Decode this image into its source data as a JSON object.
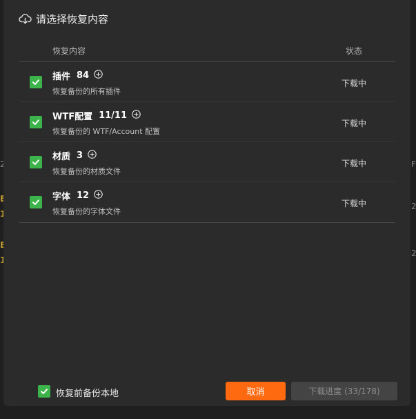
{
  "backdrop": {
    "left_fragments": [
      "2",
      "E",
      "1",
      "E",
      "1"
    ],
    "right_fragments": [
      "F",
      "2",
      "2"
    ]
  },
  "dialog": {
    "title": "请选择恢复内容",
    "title_icon": "cloud-download-icon",
    "columns": {
      "content": "恢复内容",
      "status": "状态"
    },
    "rows": [
      {
        "name": "插件",
        "count": "84",
        "desc": "恢复备份的所有插件",
        "status": "下载中",
        "checked": true
      },
      {
        "name": "WTF配置",
        "count": "11/11",
        "desc": "恢复备份的 WTF/Account 配置",
        "status": "下载中",
        "checked": true
      },
      {
        "name": "材质",
        "count": "3",
        "desc": "恢复备份的材质文件",
        "status": "下载中",
        "checked": true
      },
      {
        "name": "字体",
        "count": "12",
        "desc": "恢复备份的字体文件",
        "status": "下载中",
        "checked": true
      }
    ],
    "footer": {
      "backup_label": "恢复前备份本地",
      "backup_checked": true,
      "cancel_label": "取消",
      "progress_label": "下载进度 (33/178)"
    },
    "colors": {
      "accent": "#ff6a10",
      "check": "#3cb44b",
      "dialog_bg": "#2b2b2b"
    }
  }
}
